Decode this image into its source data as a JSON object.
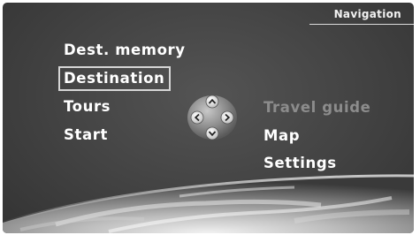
{
  "header": {
    "title": "Navigation"
  },
  "menu": {
    "left": [
      {
        "label": "Dest. memory",
        "state": "normal"
      },
      {
        "label": "Destination",
        "state": "selected"
      },
      {
        "label": "Tours",
        "state": "normal"
      },
      {
        "label": "Start",
        "state": "normal"
      }
    ],
    "right": [
      {
        "label": "Travel guide",
        "state": "disabled"
      },
      {
        "label": "Map",
        "state": "normal"
      },
      {
        "label": "Settings",
        "state": "normal"
      }
    ]
  },
  "controller": {
    "icons": [
      "arrow-up-icon",
      "arrow-down-icon",
      "arrow-left-icon",
      "arrow-right-icon"
    ]
  },
  "colors": {
    "background": "#444444",
    "text": "#ffffff",
    "disabled_text": "#8c8c8c",
    "selection_border": "#d6d6d6"
  }
}
